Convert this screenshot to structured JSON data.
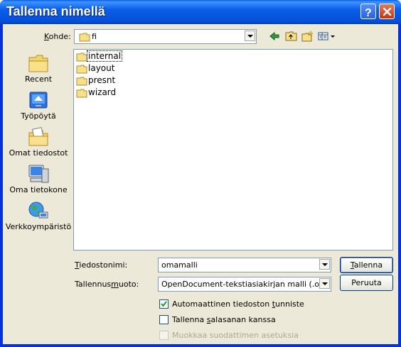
{
  "window": {
    "title": "Tallenna nimellä"
  },
  "lookin": {
    "label_pre": "K",
    "label_rest": "ohde:",
    "value": "fi"
  },
  "toolbar": {
    "icons": [
      "back-arrow-icon",
      "up-folder-icon",
      "new-folder-icon",
      "view-menu-icon"
    ]
  },
  "places": [
    {
      "label": "Recent",
      "icon": "recent-folder-icon"
    },
    {
      "label": "Työpöytä",
      "icon": "desktop-icon"
    },
    {
      "label": "Omat tiedostot",
      "icon": "my-documents-icon"
    },
    {
      "label": "Oma tietokone",
      "icon": "my-computer-icon"
    },
    {
      "label": "Verkkoympäristö",
      "icon": "network-icon"
    }
  ],
  "files": [
    {
      "name": "internal"
    },
    {
      "name": "layout"
    },
    {
      "name": "presnt"
    },
    {
      "name": "wizard"
    }
  ],
  "filename": {
    "label_pre": "T",
    "label_rest": "iedostonimi:",
    "value": "omamalli"
  },
  "filetype": {
    "label_a": "Tallennus",
    "label_u": "m",
    "label_b": "uoto:",
    "value": "OpenDocument-tekstiasiakirjan malli (.ott)"
  },
  "buttons": {
    "save_pre": "T",
    "save_rest": "allenna",
    "cancel": "Peruuta"
  },
  "checkboxes": [
    {
      "pre": "Automaattinen tiedoston ",
      "u": "t",
      "post": "unniste",
      "checked": true,
      "enabled": true
    },
    {
      "pre": "Tallenna ",
      "u": "s",
      "post": "alasanan kanssa",
      "checked": false,
      "enabled": true
    },
    {
      "pre": "Muokkaa suodattimen asetuksia",
      "u": "",
      "post": "",
      "checked": false,
      "enabled": false
    }
  ]
}
